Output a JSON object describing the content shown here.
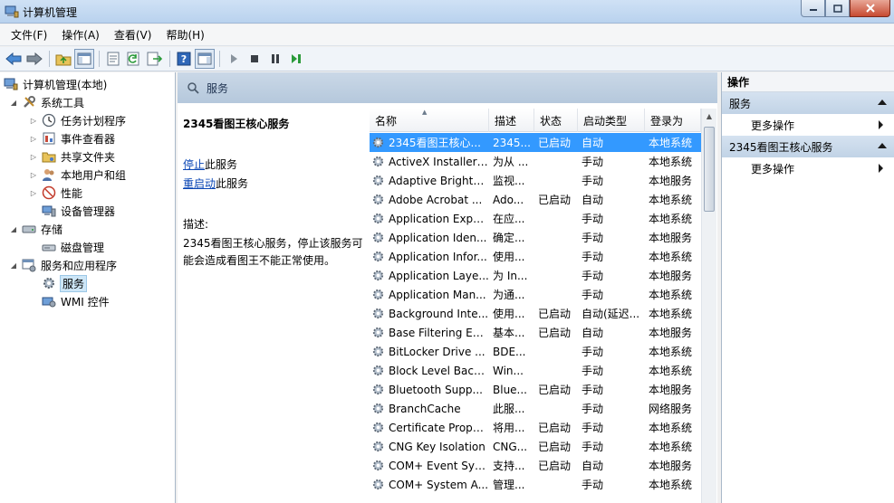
{
  "window": {
    "title": "计算机管理"
  },
  "menu": [
    "文件(F)",
    "操作(A)",
    "查看(V)",
    "帮助(H)"
  ],
  "tree": [
    {
      "label": "计算机管理(本地)",
      "level": 0,
      "exp": ""
    },
    {
      "label": "系统工具",
      "level": 1,
      "exp": "◢"
    },
    {
      "label": "任务计划程序",
      "level": 2,
      "exp": "▷"
    },
    {
      "label": "事件查看器",
      "level": 2,
      "exp": "▷"
    },
    {
      "label": "共享文件夹",
      "level": 2,
      "exp": "▷"
    },
    {
      "label": "本地用户和组",
      "level": 2,
      "exp": "▷"
    },
    {
      "label": "性能",
      "level": 2,
      "exp": "▷"
    },
    {
      "label": "设备管理器",
      "level": 2,
      "exp": ""
    },
    {
      "label": "存储",
      "level": 1,
      "exp": "◢"
    },
    {
      "label": "磁盘管理",
      "level": 2,
      "exp": ""
    },
    {
      "label": "服务和应用程序",
      "level": 1,
      "exp": "◢"
    },
    {
      "label": "服务",
      "level": 2,
      "exp": ""
    },
    {
      "label": "WMI 控件",
      "level": 2,
      "exp": ""
    }
  ],
  "center": {
    "header": "服务",
    "selected_title": "2345看图王核心服务",
    "stop_link": "停止",
    "stop_rest": "此服务",
    "restart_link": "重启动",
    "restart_rest": "此服务",
    "desc_label": "描述:",
    "desc_text": "2345看图王核心服务，停止该服务可能会造成看图王不能正常使用。"
  },
  "columns": [
    "名称",
    "描述",
    "状态",
    "启动类型",
    "登录为"
  ],
  "rows": [
    [
      "2345看图王核心...",
      "2345...",
      "已启动",
      "自动",
      "本地系统"
    ],
    [
      "ActiveX Installer ...",
      "为从 ...",
      "",
      "手动",
      "本地系统"
    ],
    [
      "Adaptive Brightn...",
      "监视...",
      "",
      "手动",
      "本地服务"
    ],
    [
      "Adobe Acrobat ...",
      "Ado...",
      "已启动",
      "自动",
      "本地系统"
    ],
    [
      "Application Expe...",
      "在应...",
      "",
      "手动",
      "本地系统"
    ],
    [
      "Application Iden...",
      "确定...",
      "",
      "手动",
      "本地服务"
    ],
    [
      "Application Infor...",
      "使用...",
      "",
      "手动",
      "本地系统"
    ],
    [
      "Application Laye...",
      "为 In...",
      "",
      "手动",
      "本地服务"
    ],
    [
      "Application Man...",
      "为通...",
      "",
      "手动",
      "本地系统"
    ],
    [
      "Background Inte...",
      "使用...",
      "已启动",
      "自动(延迟...",
      "本地系统"
    ],
    [
      "Base Filtering En...",
      "基本...",
      "已启动",
      "自动",
      "本地服务"
    ],
    [
      "BitLocker Drive ...",
      "BDE...",
      "",
      "手动",
      "本地系统"
    ],
    [
      "Block Level Back...",
      "Win...",
      "",
      "手动",
      "本地系统"
    ],
    [
      "Bluetooth Supp...",
      "Blue...",
      "已启动",
      "手动",
      "本地服务"
    ],
    [
      "BranchCache",
      "此服...",
      "",
      "手动",
      "网络服务"
    ],
    [
      "Certificate Propa...",
      "将用...",
      "已启动",
      "手动",
      "本地系统"
    ],
    [
      "CNG Key Isolation",
      "CNG...",
      "已启动",
      "手动",
      "本地系统"
    ],
    [
      "COM+ Event Sys...",
      "支持...",
      "已启动",
      "自动",
      "本地服务"
    ],
    [
      "COM+ System A...",
      "管理...",
      "",
      "手动",
      "本地系统"
    ]
  ],
  "actions": {
    "header": "操作",
    "section1": "服务",
    "section2": "2345看图王核心服务",
    "more": "更多操作"
  },
  "colors": {
    "selection": "#3399ff",
    "link": "#0a46b4"
  }
}
